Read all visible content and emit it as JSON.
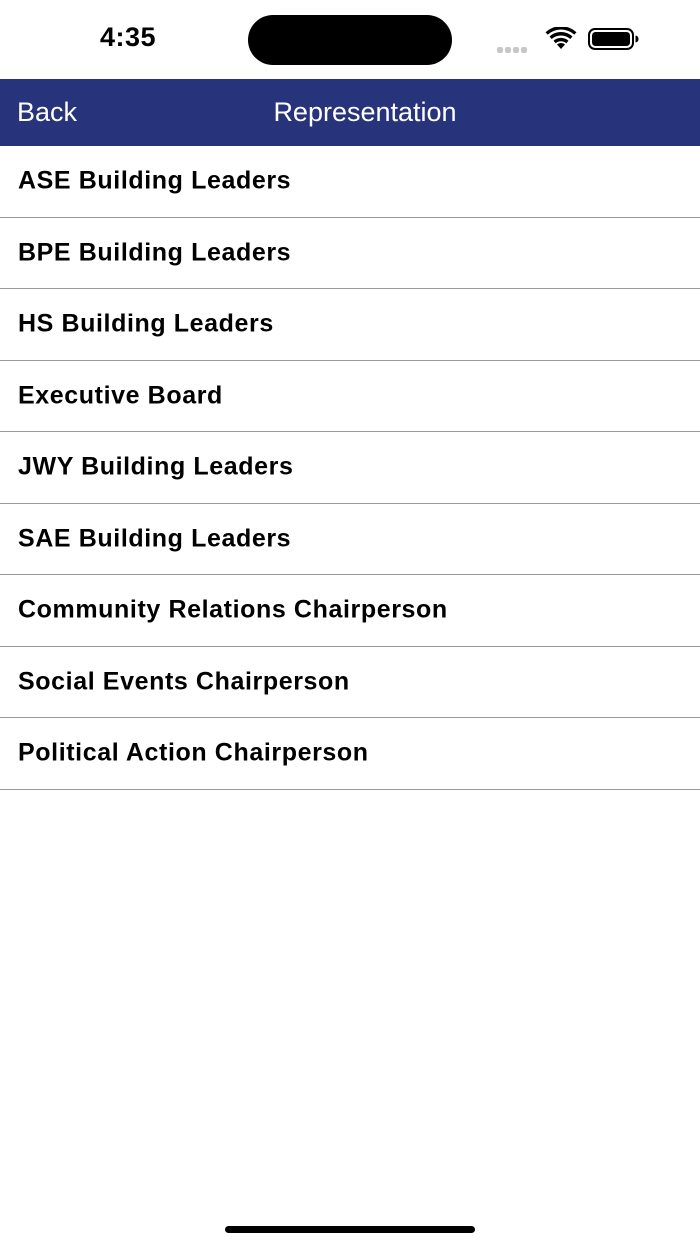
{
  "status_bar": {
    "time": "4:35",
    "icons": [
      "signal-icon",
      "wifi-icon",
      "battery-icon"
    ]
  },
  "nav": {
    "back_label": "Back",
    "title": "Representation",
    "background_color": "#27337b"
  },
  "list": {
    "items": [
      {
        "label": "ASE Building Leaders"
      },
      {
        "label": "BPE Building Leaders"
      },
      {
        "label": "HS Building Leaders"
      },
      {
        "label": "Executive Board"
      },
      {
        "label": "JWY Building Leaders"
      },
      {
        "label": "SAE Building Leaders"
      },
      {
        "label": "Community Relations Chairperson"
      },
      {
        "label": "Social Events Chairperson"
      },
      {
        "label": "Political Action Chairperson"
      }
    ]
  }
}
